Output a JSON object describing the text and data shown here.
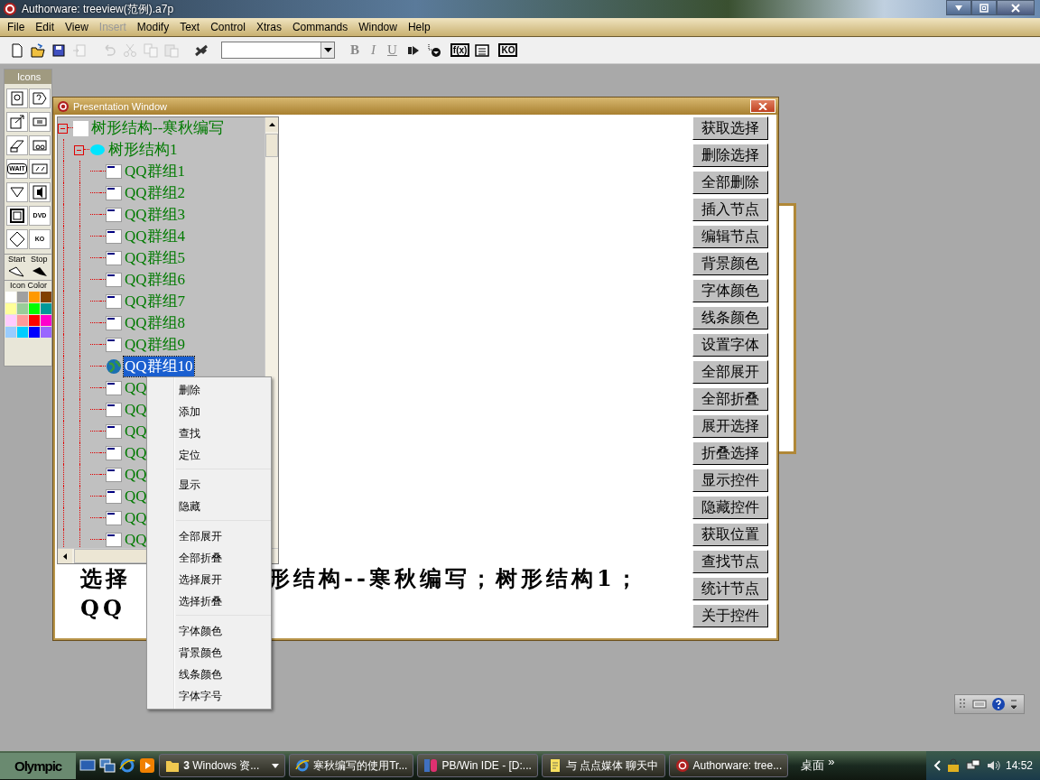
{
  "app_window": {
    "title": "Authorware: treeview(范例).a7p"
  },
  "menu_bar": [
    {
      "label": "File",
      "disabled": false
    },
    {
      "label": "Edit",
      "disabled": false
    },
    {
      "label": "View",
      "disabled": false
    },
    {
      "label": "Insert",
      "disabled": true
    },
    {
      "label": "Modify",
      "disabled": false
    },
    {
      "label": "Text",
      "disabled": false
    },
    {
      "label": "Control",
      "disabled": false
    },
    {
      "label": "Xtras",
      "disabled": false
    },
    {
      "label": "Commands",
      "disabled": false
    },
    {
      "label": "Window",
      "disabled": false
    },
    {
      "label": "Help",
      "disabled": false
    }
  ],
  "toolbar": {
    "left_tools": [
      {
        "kind": "new",
        "disabled": false
      },
      {
        "kind": "open",
        "disabled": false
      },
      {
        "kind": "save",
        "disabled": false
      },
      {
        "kind": "import",
        "disabled": true
      },
      {
        "kind": "undo",
        "disabled": true
      },
      {
        "kind": "cut",
        "disabled": true
      },
      {
        "kind": "copy",
        "disabled": true
      },
      {
        "kind": "paste",
        "disabled": true
      },
      {
        "kind": "function",
        "disabled": false
      }
    ],
    "format_buttons": [
      "B",
      "I",
      "U"
    ],
    "right_tools": [
      {
        "kind": "play"
      },
      {
        "kind": "trace"
      },
      {
        "kind": "fx",
        "label": "f(x)"
      },
      {
        "kind": "list"
      },
      {
        "kind": "ko",
        "label": "KO"
      }
    ]
  },
  "icons_palette": {
    "title": "Icons",
    "tools": [
      {
        "kind": "display"
      },
      {
        "kind": "question"
      },
      {
        "kind": "motion"
      },
      {
        "kind": "calculation"
      },
      {
        "kind": "erase"
      },
      {
        "kind": "video"
      },
      {
        "kind": "wait",
        "label": "WAIT"
      },
      {
        "kind": "movie"
      },
      {
        "kind": "decision"
      },
      {
        "kind": "sound"
      },
      {
        "kind": "framework"
      },
      {
        "kind": "dvd",
        "label": "DVD"
      },
      {
        "kind": "diamond"
      },
      {
        "kind": "ko",
        "label": "KO"
      }
    ],
    "start_label": "Start",
    "stop_label": "Stop",
    "color_title": "Icon Color",
    "colors": [
      {
        "color": "#ffffff"
      },
      {
        "color": "#a0a0a0"
      },
      {
        "color": "#ff9900"
      },
      {
        "color": "#804000"
      },
      {
        "color": "#ffff99"
      },
      {
        "color": "#99cc99"
      },
      {
        "color": "#00ff00"
      },
      {
        "color": "#009999"
      },
      {
        "color": "#ffccff"
      },
      {
        "color": "#ff9999"
      },
      {
        "color": "#ff0000"
      },
      {
        "color": "#ff00cc"
      },
      {
        "color": "#99ccff"
      },
      {
        "color": "#00ccff"
      },
      {
        "color": "#0000ff"
      },
      {
        "color": "#9966ff"
      }
    ]
  },
  "presentation_window": {
    "title": "Presentation Window",
    "tree": {
      "items": [
        {
          "label": "树形结构--寒秋编写",
          "kind": "blank",
          "expanded": true,
          "selected": false,
          "children": [
            {
              "label": "树形结构1",
              "kind": "cloud",
              "expanded": true,
              "selected": false,
              "children": [
                {
                  "label": "QQ群组1",
                  "kind": "window",
                  "selected": false
                },
                {
                  "label": "QQ群组2",
                  "kind": "window",
                  "selected": false
                },
                {
                  "label": "QQ群组3",
                  "kind": "window",
                  "selected": false
                },
                {
                  "label": "QQ群组4",
                  "kind": "window",
                  "selected": false
                },
                {
                  "label": "QQ群组5",
                  "kind": "window",
                  "selected": false
                },
                {
                  "label": "QQ群组6",
                  "kind": "window",
                  "selected": false
                },
                {
                  "label": "QQ群组7",
                  "kind": "window",
                  "selected": false
                },
                {
                  "label": "QQ群组8",
                  "kind": "window",
                  "selected": false
                },
                {
                  "label": "QQ群组9",
                  "kind": "window",
                  "selected": false
                },
                {
                  "label": "QQ群组10",
                  "kind": "globe",
                  "selected": true
                },
                {
                  "label": "QQ",
                  "kind": "window",
                  "selected": false
                },
                {
                  "label": "QQ",
                  "kind": "window",
                  "selected": false
                },
                {
                  "label": "QQ",
                  "kind": "window",
                  "selected": false
                },
                {
                  "label": "QQ",
                  "kind": "window",
                  "selected": false
                },
                {
                  "label": "QQ",
                  "kind": "window",
                  "selected": false
                },
                {
                  "label": "QQ",
                  "kind": "window",
                  "selected": false
                },
                {
                  "label": "QQ",
                  "kind": "window",
                  "selected": false
                },
                {
                  "label": "QQ",
                  "kind": "window",
                  "selected": false
                }
              ]
            }
          ]
        }
      ]
    },
    "buttons": [
      "获取选择",
      "删除选择",
      "全部删除",
      "插入节点",
      "编辑节点",
      "背景颜色",
      "字体颜色",
      "线条颜色",
      "设置字体",
      "全部展开",
      "全部折叠",
      "展开选择",
      "折叠选择",
      "显示控件",
      "隐藏控件",
      "获取位置",
      "查找节点",
      "统计节点",
      "关于控件"
    ],
    "status_text": [
      {
        "parts": [
          "选择",
          "形结构--寒秋编写；树形结构1；"
        ]
      },
      {
        "parts": [
          "QQ"
        ]
      }
    ]
  },
  "context_menu": {
    "groups": [
      {
        "items": [
          "删除",
          "添加",
          "查找",
          "定位"
        ]
      },
      {
        "items": [
          "显示",
          "隐藏"
        ]
      },
      {
        "items": [
          "全部展开",
          "全部折叠",
          "选择展开",
          "选择折叠"
        ]
      },
      {
        "items": [
          "字体颜色",
          "背景颜色",
          "线条颜色",
          "字体字号"
        ]
      }
    ]
  },
  "taskbar": {
    "start_label": "Olympic",
    "quick_launch": [
      {
        "kind": "desktop"
      },
      {
        "kind": "switch"
      },
      {
        "kind": "browser"
      },
      {
        "kind": "player"
      }
    ],
    "tasks": [
      {
        "label": "**3** Windows 资...",
        "kind": "folder"
      },
      {
        "label": "寒秋编写的使用Tr...",
        "kind": "browser"
      },
      {
        "label": "PB/Win IDE - [D:...",
        "kind": "pb"
      },
      {
        "label": "与 点点媒体 聊天中",
        "kind": "note"
      },
      {
        "label": "Authorware: tree...",
        "kind": "authorware"
      }
    ],
    "desktop_label": "桌面",
    "chevron": "»",
    "clock": "14:52"
  }
}
